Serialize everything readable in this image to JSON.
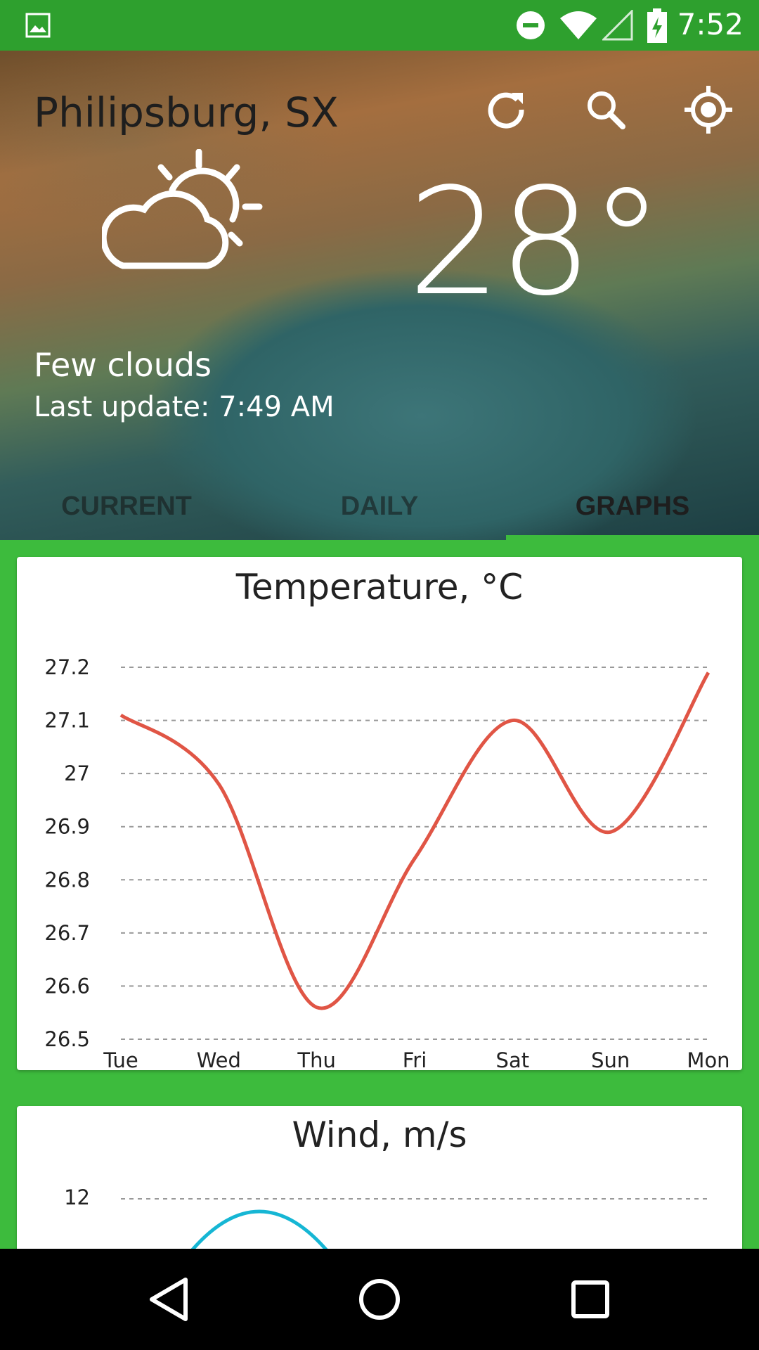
{
  "status_bar": {
    "time": "7:52"
  },
  "header": {
    "city": "Philipsburg, SX",
    "temperature": "28°",
    "condition": "Few clouds",
    "last_update": "Last update: 7:49 AM",
    "icons": [
      "refresh-icon",
      "search-icon",
      "location-icon",
      "partly-cloudy-icon"
    ]
  },
  "tabs": [
    {
      "label": "CURRENT",
      "active": false
    },
    {
      "label": "DAILY",
      "active": false
    },
    {
      "label": "GRAPHS",
      "active": true
    }
  ],
  "colors": {
    "accent": "#3dbb3d",
    "status_bar": "#2ea02e",
    "temperature_line": "#e05545",
    "wind_line": "#16b6d4"
  },
  "chart_data": [
    {
      "type": "line",
      "title": "Temperature, °C",
      "categories": [
        "Tue",
        "Wed",
        "Thu",
        "Fri",
        "Sat",
        "Sun",
        "Mon"
      ],
      "series": [
        {
          "values": [
            27.11,
            26.98,
            26.56,
            26.84,
            27.1,
            26.89,
            27.19
          ]
        }
      ],
      "yticks": [
        "27.2",
        "27.1",
        "27",
        "26.9",
        "26.8",
        "26.7",
        "26.6",
        "26.5"
      ],
      "ylim": [
        26.5,
        27.2
      ],
      "grid": true
    },
    {
      "type": "line",
      "title": "Wind, m/s",
      "yticks": [
        "12"
      ],
      "series": [
        {
          "values": []
        }
      ],
      "grid": true
    }
  ]
}
